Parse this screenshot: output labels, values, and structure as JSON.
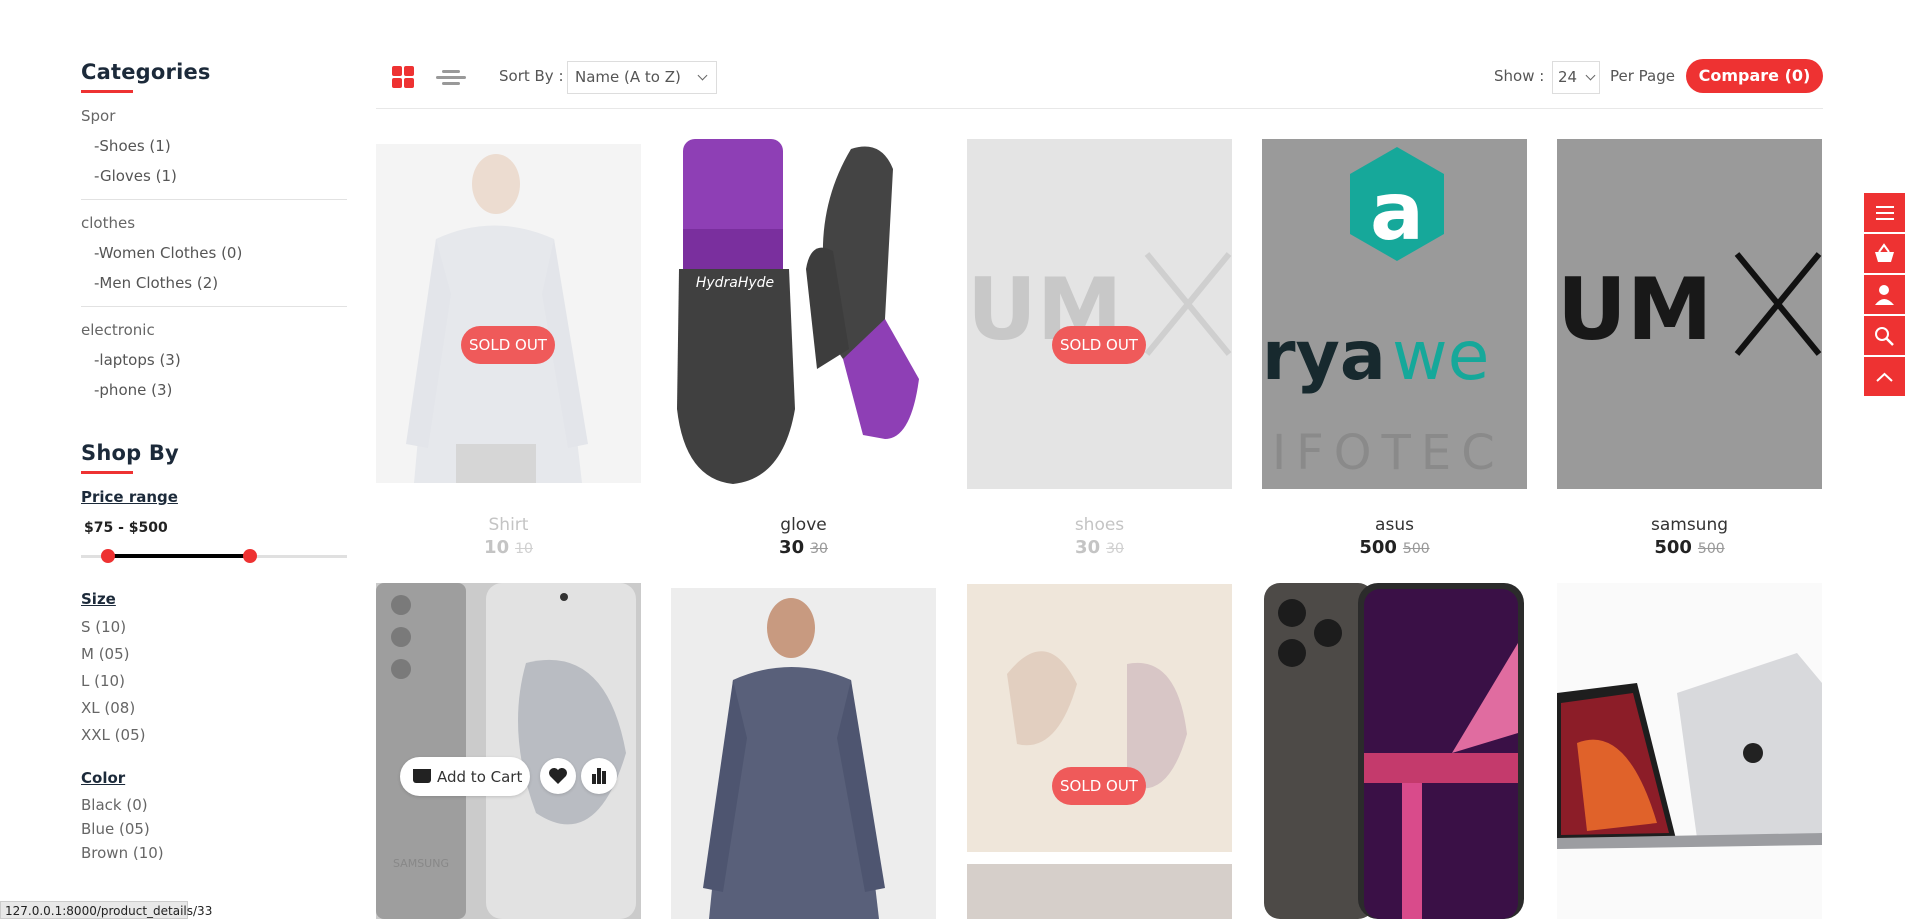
{
  "sidebar": {
    "categories_title": "Categories",
    "groups": [
      {
        "name": "Spor",
        "children": [
          "-Shoes (1)",
          "-Gloves (1)"
        ]
      },
      {
        "name": "clothes",
        "children": [
          "-Women Clothes (0)",
          "-Men Clothes (2)"
        ]
      },
      {
        "name": "electronic",
        "children": [
          "-laptops (3)",
          "-phone (3)"
        ]
      }
    ],
    "shop_by_title": "Shop By",
    "price": {
      "title": "Price range",
      "value": "$75 - $500",
      "min": 75,
      "max": 500
    },
    "size": {
      "title": "Size",
      "options": [
        "S (10)",
        "M (05)",
        "L (10)",
        "XL (08)",
        "XXL (05)"
      ]
    },
    "color": {
      "title": "Color",
      "options": [
        "Black (0)",
        "Blue (05)",
        "Brown (10)"
      ]
    }
  },
  "toolbar": {
    "sort_label": "Sort By :",
    "sort_value": "Name (A to Z)",
    "show_label": "Show :",
    "show_value": "24",
    "per_page_label": "Per Page",
    "compare_label": "Compare (0)"
  },
  "products": [
    {
      "name": "Shirt",
      "price": "10",
      "old_price": "10",
      "sold_out": true
    },
    {
      "name": "glove",
      "price": "30",
      "old_price": "30",
      "sold_out": false
    },
    {
      "name": "shoes",
      "price": "30",
      "old_price": "30",
      "sold_out": true
    },
    {
      "name": "asus",
      "price": "500",
      "old_price": "500",
      "sold_out": false
    },
    {
      "name": "samsung",
      "price": "500",
      "old_price": "500",
      "sold_out": false
    }
  ],
  "sold_out_label": "SOLD OUT",
  "add_to_cart_label": "Add to Cart",
  "brand_texts": {
    "glove": "HydraHyde",
    "um": "UM",
    "rya": "rya",
    "we": "we",
    "infotec": "IFOTEC",
    "a": "a",
    "samsung": "SAMSUNG"
  },
  "status_url": "127.0.0.1:8000/product_details/33",
  "colors": {
    "accent": "#ee3232"
  }
}
